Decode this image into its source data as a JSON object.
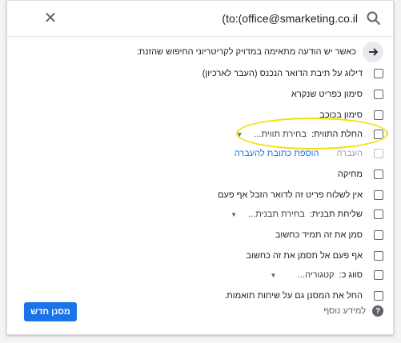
{
  "window": {
    "close_icon": "close-icon",
    "query": "(to:(office@smarketing.co.il",
    "search_icon": "search-icon"
  },
  "info": {
    "text": "כאשר יש הודעה מתאימה במדויק לקריטריוני החיפוש שהזנת:",
    "icon": "arrow-right-icon"
  },
  "options": [
    {
      "label": "דילוג על תיבת הדואר הנכנס (העבר לארכיון)"
    },
    {
      "label": "סימון כפריט שנקרא"
    },
    {
      "label": "סימון בכוכב"
    },
    {
      "label": "החלת התווית:",
      "select": "בחירת תווית..."
    },
    {
      "label": "העברה",
      "link": "הוספת כתובת להעברה",
      "disabled": true
    },
    {
      "label": "מחיקה"
    },
    {
      "label": "אין לשלוח פריט זה לדואר הזבל אף פעם"
    },
    {
      "label": "שליחת תבנית:",
      "select": "בחירת תבנית..."
    },
    {
      "label": "סמן את זה תמיד כחשוב"
    },
    {
      "label": "אף פעם אל תסמן את זה כחשוב"
    },
    {
      "label": "סווג כ:",
      "select": "קטגוריה..."
    },
    {
      "label": "החל את המסנן גם על שיחות תואמות."
    }
  ],
  "footer": {
    "help": "למידע נוסף",
    "create_button": "מסנן חדש"
  },
  "colors": {
    "accent": "#1a73e8",
    "highlight": "#f4e000"
  }
}
